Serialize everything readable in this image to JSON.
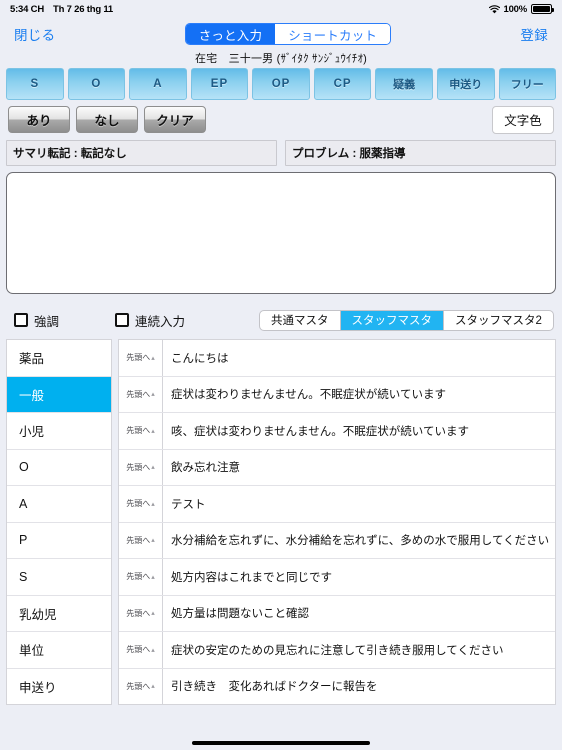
{
  "statusbar": {
    "time": "5:34 CH",
    "date": "Th 7 26 thg 11",
    "battery_percent": "100%",
    "wifi_icon": "wifi-icon",
    "battery_icon": "battery-full-icon"
  },
  "navbar": {
    "close_label": "閉じる",
    "register_label": "登録",
    "segments": [
      {
        "label": "さっと入力",
        "selected": true
      },
      {
        "label": "ショートカット",
        "selected": false
      }
    ]
  },
  "patient": {
    "info": "在宅　三十一男 (ｻﾞｲﾀｸ ｻﾝｼﾞｭｳｲﾁｵ)"
  },
  "soap_buttons": [
    {
      "label": "S"
    },
    {
      "label": "O"
    },
    {
      "label": "A"
    },
    {
      "label": "EP"
    },
    {
      "label": "OP"
    },
    {
      "label": "CP"
    },
    {
      "label": "疑義"
    },
    {
      "label": "申送り"
    },
    {
      "label": "フリー"
    }
  ],
  "action_buttons": {
    "ari": "あり",
    "nashi": "なし",
    "clear": "クリア",
    "text_color": "文字色"
  },
  "info_bars": {
    "summary": "サマリ転記 : 転記なし",
    "problem": "プロブレム : 服薬指導"
  },
  "editor": {
    "value": "",
    "placeholder": ""
  },
  "options": {
    "emphasis_label": "強調",
    "emphasis_checked": false,
    "continuous_label": "連続入力",
    "continuous_checked": false,
    "master_segments": [
      {
        "label": "共通マスタ",
        "selected": false
      },
      {
        "label": "スタッフマスタ",
        "selected": true
      },
      {
        "label": "スタッフマスタ2",
        "selected": false
      }
    ]
  },
  "categories": [
    {
      "label": "薬品",
      "selected": false
    },
    {
      "label": "一般",
      "selected": true
    },
    {
      "label": "小児",
      "selected": false
    },
    {
      "label": "O",
      "selected": false
    },
    {
      "label": "A",
      "selected": false
    },
    {
      "label": "P",
      "selected": false
    },
    {
      "label": "S",
      "selected": false
    },
    {
      "label": "乳幼児",
      "selected": false
    },
    {
      "label": "単位",
      "selected": false
    },
    {
      "label": "申送り",
      "selected": false
    }
  ],
  "row_button_label": "先頭へ",
  "phrases": [
    {
      "text": "こんにちは"
    },
    {
      "text": "症状は変わりませんません。不眠症状が続いています"
    },
    {
      "text": "咳、症状は変わりませんません。不眠症状が続いています"
    },
    {
      "text": "飲み忘れ注意"
    },
    {
      "text": "テスト"
    },
    {
      "text": "水分補給を忘れずに、水分補給を忘れずに、多めの水で服用してください"
    },
    {
      "text": "処方内容はこれまでと同じです"
    },
    {
      "text": "処方量は問題ないこと確認"
    },
    {
      "text": "症状の安定のための見忘れに注意して引き続き服用してください"
    },
    {
      "text": "引き続き　変化あればドクターに報告を"
    }
  ],
  "colors": {
    "accent_blue": "#1470f5",
    "cyan_select": "#00b0ef",
    "soap_blue": "#8dd1ef",
    "background": "#eceef5"
  }
}
